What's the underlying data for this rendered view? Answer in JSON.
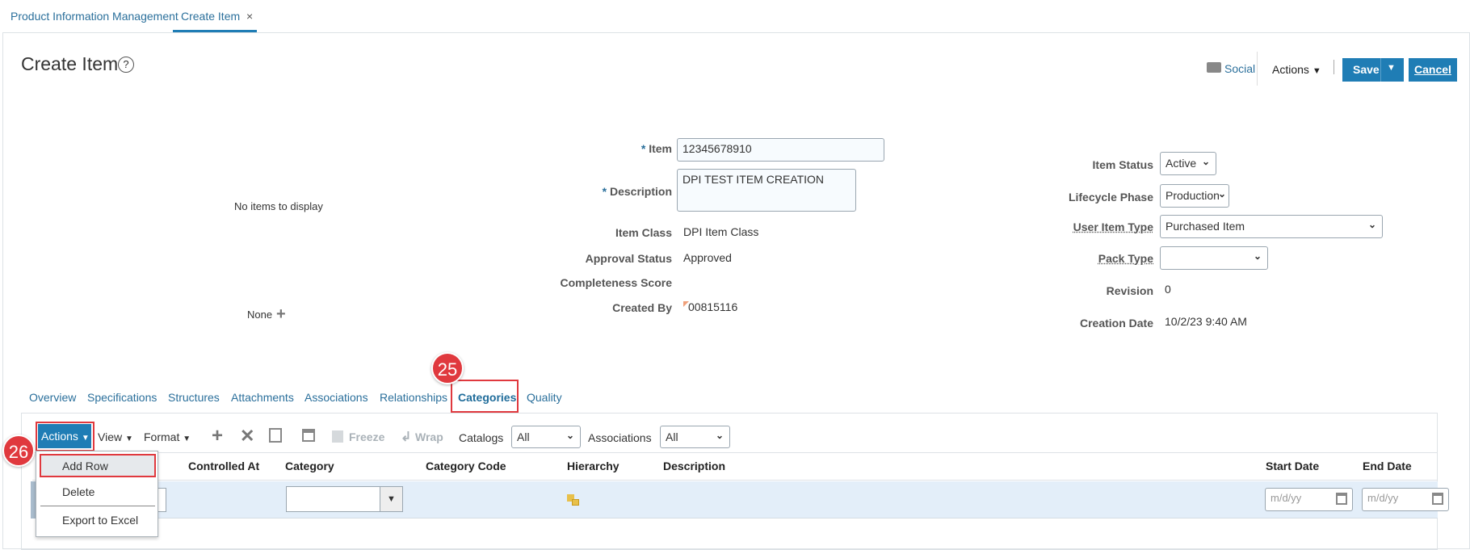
{
  "top_tabs": [
    {
      "label": "Product Information Management"
    },
    {
      "label": "Create Item",
      "close": "×"
    }
  ],
  "header": {
    "title": "Create Item",
    "help_icon": "?",
    "social": "Social",
    "actions": "Actions",
    "save": "Save",
    "cancel": "Cancel"
  },
  "left": {
    "no_items": "No items to display",
    "none": "None"
  },
  "form": {
    "item_label": "Item",
    "item_value": "12345678910",
    "description_label": "Description",
    "description_value": "DPI TEST ITEM CREATION",
    "item_class_label": "Item Class",
    "item_class_value": "DPI Item Class",
    "approval_label": "Approval Status",
    "approval_value": "Approved",
    "completeness_label": "Completeness Score",
    "created_by_label": "Created By",
    "created_by_value": "00815116",
    "required_mark": "*"
  },
  "right_form": {
    "item_status_label": "Item Status",
    "item_status_value": "Active",
    "lifecycle_label": "Lifecycle Phase",
    "lifecycle_value": "Production",
    "user_item_type_label": "User Item Type",
    "user_item_type_value": "Purchased Item",
    "pack_type_label": "Pack Type",
    "pack_type_value": "",
    "revision_label": "Revision",
    "revision_value": "0",
    "creation_date_label": "Creation Date",
    "creation_date_value": "10/2/23 9:40 AM"
  },
  "subtabs": [
    "Overview",
    "Specifications",
    "Structures",
    "Attachments",
    "Associations",
    "Relationships",
    "Categories",
    "Quality"
  ],
  "active_subtab": "Categories",
  "toolbar": {
    "actions": "Actions",
    "view": "View",
    "format": "Format",
    "freeze": "Freeze",
    "wrap": "Wrap",
    "catalogs_label": "Catalogs",
    "catalogs_value": "All",
    "associations_label": "Associations",
    "associations_value": "All"
  },
  "table": {
    "columns": [
      "Controlled At",
      "Category",
      "Category Code",
      "Hierarchy",
      "Description",
      "Start Date",
      "End Date"
    ],
    "date_placeholder": "m/d/yy"
  },
  "menu": {
    "items": [
      "Add Row",
      "Delete",
      "Export to Excel"
    ]
  },
  "annotations": {
    "step25": "25",
    "step26": "26"
  },
  "colors": {
    "accent": "#1f7db5",
    "link": "#2a6f9b",
    "highlight": "#e0393e",
    "row_selected": "#e3eef9"
  }
}
